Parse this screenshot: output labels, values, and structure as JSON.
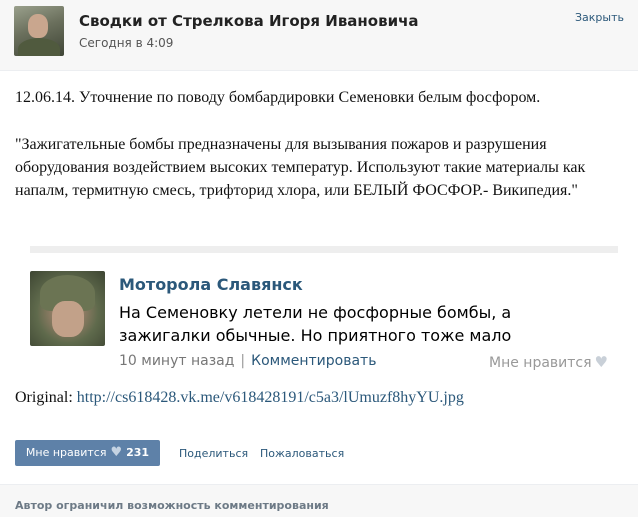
{
  "header": {
    "title": "Сводки от Стрелкова Игоря Ивановича",
    "time": "Сегодня в 4:09",
    "close_label": "Закрыть"
  },
  "post": {
    "paragraph1": "12.06.14. Уточнение по поводу бомбардировки Семеновки белым фосфором.",
    "paragraph2": "\"Зажигательные бомбы предназначены для вызывания пожаров и разрушения оборудования воздействием высоких температур. Используют такие материалы как напалм, термитную смесь, трифторид хлора, или БЕЛЫЙ ФОСФОР.- Википедия.\""
  },
  "repost": {
    "name": "Моторола Славянск",
    "text": "На Семеновку летели не фосфорные бомбы, а зажигалки обычные. Но приятного тоже мало",
    "time": "10 минут назад",
    "separator": "|",
    "comment_label": "Комментировать",
    "like_label": "Мне нравится"
  },
  "original": {
    "label": "Original:",
    "url": "http://cs618428.vk.me/v618428191/c5a3/lUmuzf8hyYU.jpg"
  },
  "actions": {
    "like_label": "Мне нравится",
    "like_count": "231",
    "share_label": "Поделиться",
    "report_label": "Пожаловаться"
  },
  "footer": {
    "notice": "Автор ограничил возможность комментирования"
  }
}
